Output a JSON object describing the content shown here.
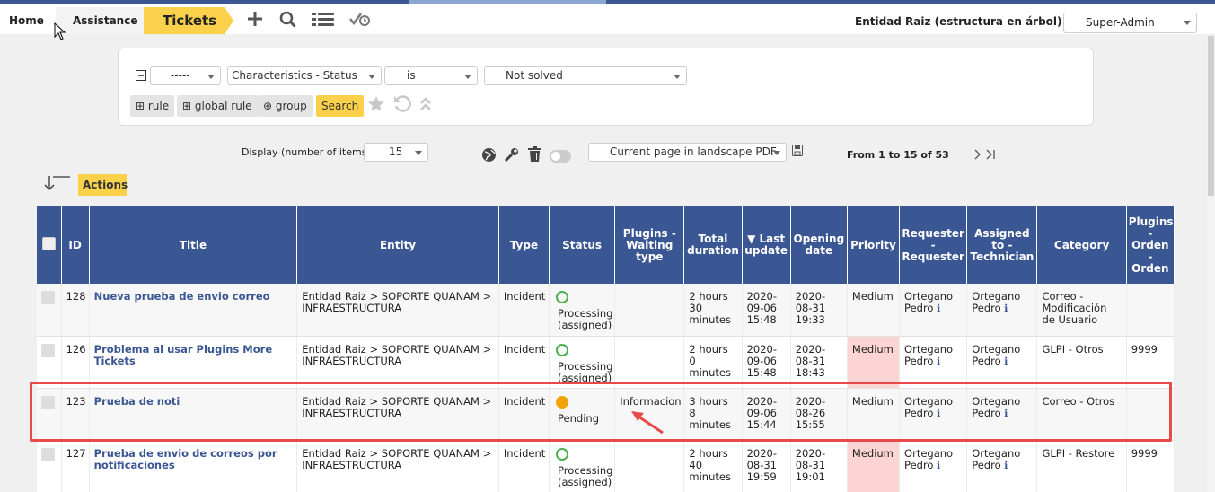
{
  "breadcrumb": {
    "home": "Home",
    "assistance": "Assistance",
    "tickets": "Tickets"
  },
  "toolbar_icons": [
    "plus-icon",
    "search-icon",
    "list-icon",
    "check-clock-icon"
  ],
  "header": {
    "entity": "Entidad Raiz (estructura en árbol)",
    "profile": "Super-Admin"
  },
  "search": {
    "rule_link": "-----",
    "field": "Characteristics - Status",
    "operator": "is",
    "value": "Not solved",
    "btn_rule": "rule",
    "btn_global_rule": "global rule",
    "btn_group": "group",
    "btn_search": "Search"
  },
  "display": {
    "label": "Display (number of items)",
    "count": "15",
    "export": "Current page in landscape PDF",
    "pager": "From 1 to 15 of 53"
  },
  "actions_label": "Actions",
  "columns": [
    "ID",
    "Title",
    "Entity",
    "Type",
    "Status",
    "Plugins - Waiting type",
    "Total duration",
    "▼ Last update",
    "Opening date",
    "Priority",
    "Requester - Requester",
    "Assigned to - Technician",
    "Category",
    "Plugins - Orden - Orden"
  ],
  "rows": [
    {
      "id": "128",
      "title": "Nueva prueba de envio correo",
      "entity": "Entidad Raiz > SOPORTE QUANAM > INFRAESTRUCTURA",
      "type": "Incident",
      "status": "Processing (assigned)",
      "status_kind": "processing",
      "waiting": "",
      "duration": "2 hours 30 minutes",
      "updated": "2020-09-06 15:48",
      "opened": "2020-08-31 19:33",
      "priority": "Medium",
      "requester": "Ortegano Pedro",
      "technician": "Ortegano Pedro",
      "category": "Correo - Modificación de Usuario",
      "orden": ""
    },
    {
      "id": "126",
      "title": "Problema al usar Plugins More Tickets",
      "entity": "Entidad Raiz > SOPORTE QUANAM > INFRAESTRUCTURA",
      "type": "Incident",
      "status": "Processing (assigned)",
      "status_kind": "processing",
      "waiting": "",
      "duration": "2 hours 0 minutes",
      "updated": "2020-09-06 15:48",
      "opened": "2020-08-31 18:43",
      "priority": "Medium",
      "requester": "Ortegano Pedro",
      "technician": "Ortegano Pedro",
      "category": "GLPI - Otros",
      "orden": "9999"
    },
    {
      "id": "123",
      "title": "Prueba de noti",
      "entity": "Entidad Raiz > SOPORTE QUANAM > INFRAESTRUCTURA",
      "type": "Incident",
      "status": "Pending",
      "status_kind": "pending",
      "waiting": "Informacion",
      "duration": "3 hours 8 minutes",
      "updated": "2020-09-06 15:44",
      "opened": "2020-08-26 15:55",
      "priority": "Medium",
      "requester": "Ortegano Pedro",
      "technician": "Ortegano Pedro",
      "category": "Correo - Otros",
      "orden": ""
    },
    {
      "id": "127",
      "title": "Prueba de envio de correos por notificaciones",
      "entity": "Entidad Raiz > SOPORTE QUANAM > INFRAESTRUCTURA",
      "type": "Incident",
      "status": "Processing (assigned)",
      "status_kind": "processing",
      "waiting": "",
      "duration": "2 hours 40 minutes",
      "updated": "2020-08-31 19:59",
      "opened": "2020-08-31 19:01",
      "priority": "Medium",
      "requester": "Ortegano Pedro",
      "technician": "Ortegano Pedro",
      "category": "GLPI - Restore",
      "orden": "9999"
    }
  ],
  "colors": {
    "header_blue": "#3a5693",
    "accent_yellow": "#fbd14b",
    "priority_medium": "#fdd4d4",
    "highlight_red": "#e84a4a",
    "processing_green": "#4cae4c",
    "pending_orange": "#f0a30a"
  }
}
